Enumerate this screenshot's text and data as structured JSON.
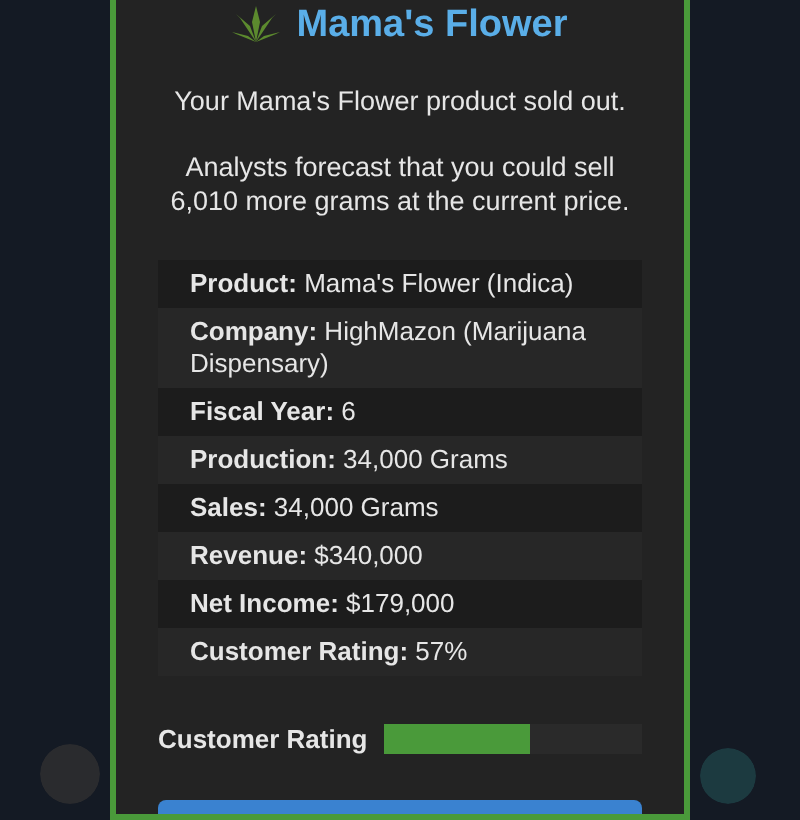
{
  "dialog": {
    "title": "Mama's Flower",
    "message": "Your Mama's Flower product sold out.",
    "forecast": "Analysts forecast that you could sell 6,010 more grams at the current price.",
    "details": [
      {
        "label": "Product:",
        "value": "Mama's Flower (Indica)"
      },
      {
        "label": "Company:",
        "value": "HighMazon (Marijuana Dispensary)"
      },
      {
        "label": "Fiscal Year:",
        "value": "6"
      },
      {
        "label": "Production:",
        "value": "34,000 Grams"
      },
      {
        "label": "Sales:",
        "value": "34,000 Grams"
      },
      {
        "label": "Revenue:",
        "value": "$340,000"
      },
      {
        "label": "Net Income:",
        "value": "$179,000"
      },
      {
        "label": "Customer Rating:",
        "value": "57%"
      }
    ],
    "rating": {
      "label": "Customer Rating",
      "level": 0.57
    }
  }
}
